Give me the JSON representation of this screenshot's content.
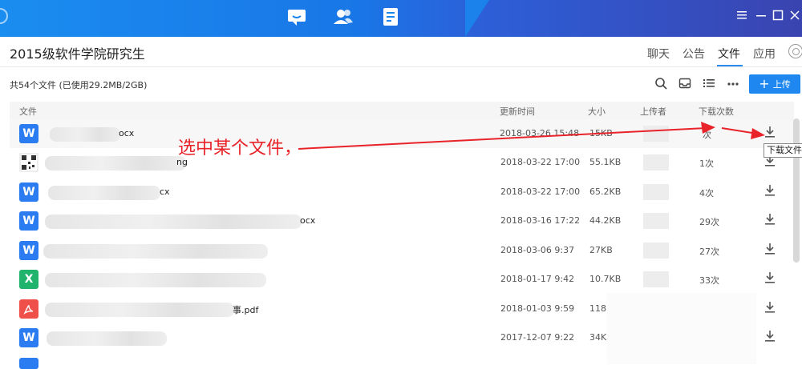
{
  "topbar": {
    "nav_icons": [
      "chat-icon",
      "contacts-icon",
      "notes-icon"
    ],
    "window_controls": [
      "menu-icon",
      "minimize-icon",
      "maximize-icon",
      "close-icon"
    ]
  },
  "header": {
    "group_name": "2015级软件学院研究生",
    "tabs": [
      {
        "label": "聊天"
      },
      {
        "label": "公告"
      },
      {
        "label": "文件"
      },
      {
        "label": "应用"
      }
    ],
    "active_tab": "文件"
  },
  "toolbar": {
    "file_info": "共54个文件 (已使用29.2MB/2GB)",
    "upload_label": "上传",
    "tools": [
      "search-icon",
      "inbox-icon",
      "list-icon",
      "more-icon"
    ]
  },
  "table": {
    "columns": [
      "文件",
      "更新时间",
      "大小",
      "上传者",
      "下载次数"
    ],
    "rows": [
      {
        "type": "word",
        "name": "ocx",
        "time": "2018-03-26 15:48",
        "size": "15KB",
        "downloads": "次"
      },
      {
        "type": "image",
        "name": "ng",
        "time": "2018-03-22 17:00",
        "size": "55.1KB",
        "downloads": "1次"
      },
      {
        "type": "word",
        "name": "cx",
        "time": "2018-03-22 17:00",
        "size": "65.2KB",
        "downloads": "4次"
      },
      {
        "type": "word",
        "name": "ocx",
        "time": "2018-03-16 17:22",
        "size": "44.2KB",
        "downloads": "29次"
      },
      {
        "type": "word",
        "name": "",
        "time": "2018-03-06 9:37",
        "size": "27KB",
        "downloads": "27次"
      },
      {
        "type": "excel",
        "name": "",
        "time": "2018-01-17 9:42",
        "size": "10.7KB",
        "downloads": "33次"
      },
      {
        "type": "pdf",
        "name": "事.pdf",
        "time": "2018-01-03 9:59",
        "size": "118K",
        "downloads": ""
      },
      {
        "type": "word",
        "name": "",
        "time": "2017-12-07 9:22",
        "size": "34K",
        "downloads": ""
      }
    ]
  },
  "tooltip": "下载文件",
  "annotation": "选中某个文件，",
  "colors": {
    "accent": "#1e88f0",
    "word": "#2b7cf0",
    "excel": "#1fb36b",
    "pdf": "#f0504a",
    "annotation": "#e8232a"
  }
}
